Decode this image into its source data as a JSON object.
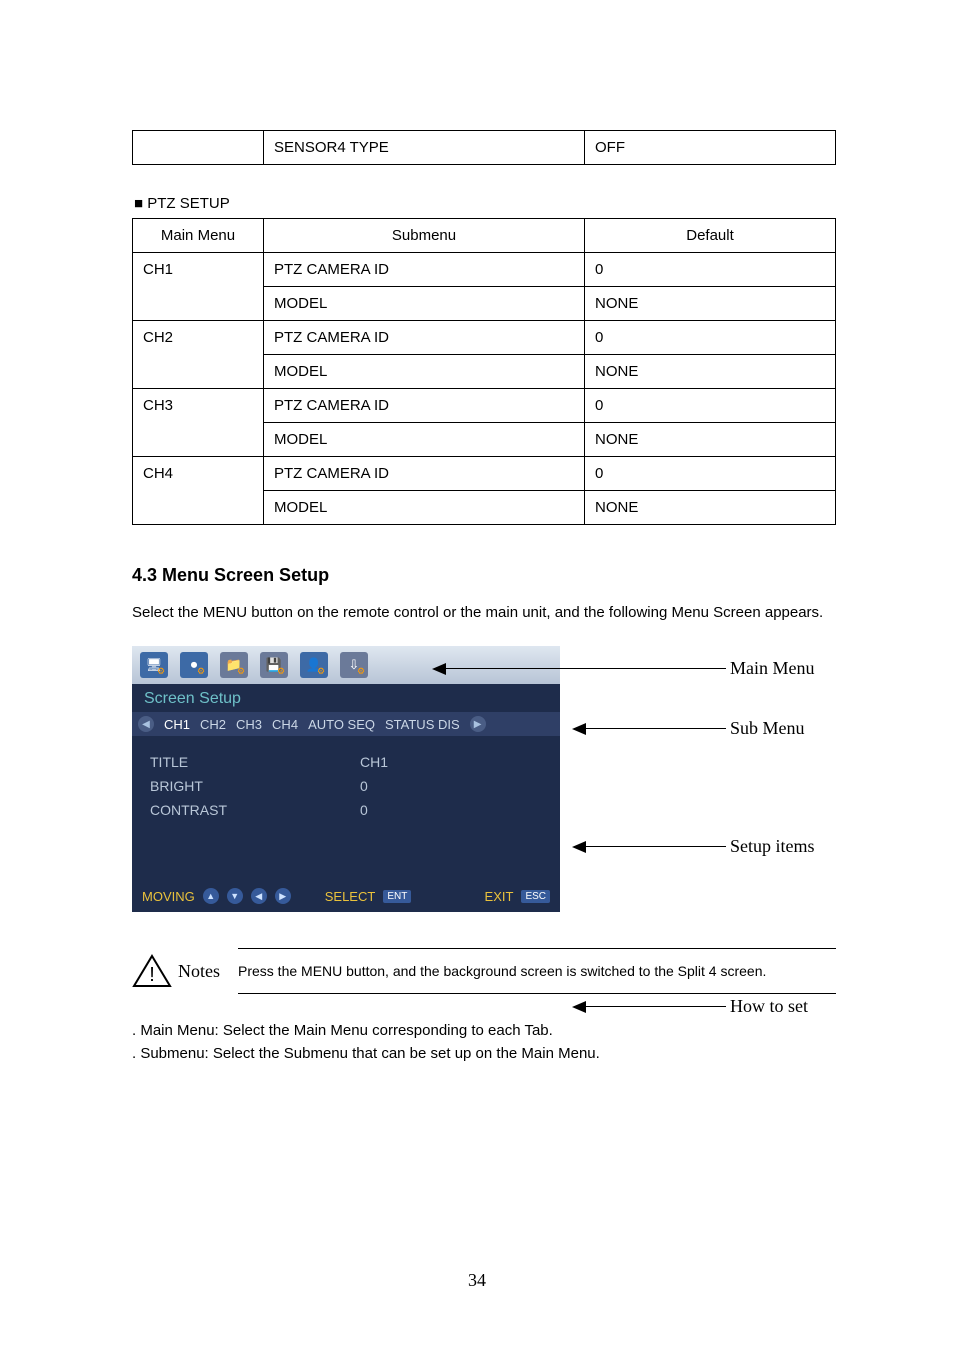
{
  "sensor_table": {
    "cell_a": "SENSOR4 TYPE",
    "cell_b": "OFF"
  },
  "ptz_heading": "■ PTZ SETUP",
  "ptz_table": {
    "headers": [
      "Main Menu",
      "Submenu",
      "Default"
    ],
    "rows": [
      {
        "main": "CH1",
        "items": [
          {
            "sub": "PTZ CAMERA ID",
            "def": "0"
          },
          {
            "sub": "MODEL",
            "def": "NONE"
          }
        ]
      },
      {
        "main": "CH2",
        "items": [
          {
            "sub": "PTZ CAMERA ID",
            "def": "0"
          },
          {
            "sub": "MODEL",
            "def": "NONE"
          }
        ]
      },
      {
        "main": "CH3",
        "items": [
          {
            "sub": "PTZ CAMERA ID",
            "def": "0"
          },
          {
            "sub": "MODEL",
            "def": "NONE"
          }
        ]
      },
      {
        "main": "CH4",
        "items": [
          {
            "sub": "PTZ CAMERA ID",
            "def": "0"
          },
          {
            "sub": "MODEL",
            "def": "NONE"
          }
        ]
      }
    ]
  },
  "section_4_3": {
    "title": "4.3 Menu Screen Setup",
    "body": "Select the MENU button on the remote control or the main unit, and the following Menu Screen appears."
  },
  "osd": {
    "title": "Screen Setup",
    "tabs": [
      "CH1",
      "CH2",
      "CH3",
      "CH4",
      "AUTO SEQ",
      "STATUS DIS"
    ],
    "setup_items": [
      {
        "key": "TITLE",
        "value": "CH1"
      },
      {
        "key": "BRIGHT",
        "value": "0"
      },
      {
        "key": "CONTRAST",
        "value": "0"
      }
    ],
    "footer": {
      "moving": "MOVING",
      "select": "SELECT",
      "select_tag": "ENT",
      "exit": "EXIT",
      "exit_tag": "ESC"
    }
  },
  "annotations": {
    "main_menu": "Main Menu",
    "sub_menu": "Sub Menu",
    "setup_items": "Setup items",
    "how_to_set": "How to set"
  },
  "notes": {
    "label": "Notes",
    "text": "Press the MENU button, and the background screen is switched to the Split 4 screen."
  },
  "list_lines": [
    ". Main Menu: Select the Main Menu corresponding to each Tab.",
    ". Submenu: Select the Submenu that can be set up on the Main Menu."
  ],
  "page_number": "34"
}
